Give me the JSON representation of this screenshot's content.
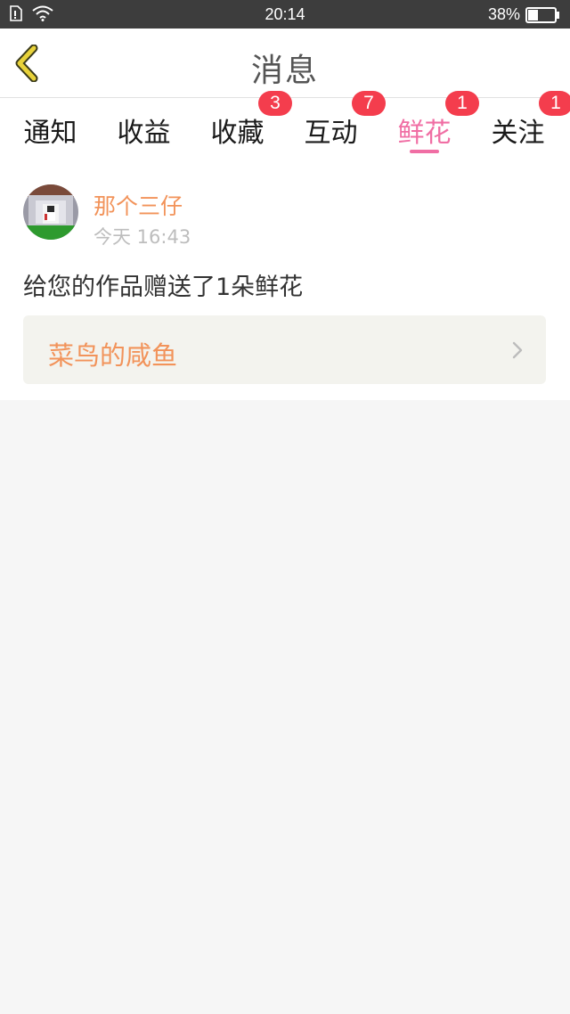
{
  "status_bar": {
    "time": "20:14",
    "battery_percent": "38%",
    "battery_level": 0.38,
    "icons": [
      "sim-icon",
      "wifi-icon",
      "battery-icon"
    ]
  },
  "header": {
    "title": "消息",
    "back_icon": "chevron-left-icon"
  },
  "tabs": [
    {
      "label": "通知",
      "badge": ""
    },
    {
      "label": "收益",
      "badge": ""
    },
    {
      "label": "收藏",
      "badge": "3"
    },
    {
      "label": "互动",
      "badge": "7"
    },
    {
      "label": "鲜花",
      "badge": "1",
      "active": true
    },
    {
      "label": "关注",
      "badge": "1"
    }
  ],
  "message": {
    "sender": "那个三仔",
    "time": "今天 16:43",
    "text": "给您的作品赠送了1朵鲜花",
    "work_title": "菜鸟的咸鱼"
  },
  "colors": {
    "accent_pink": "#f06ea4",
    "badge_red": "#f43d4d",
    "orange_text": "#f2935a",
    "back_arrow": "#e8d23a"
  }
}
